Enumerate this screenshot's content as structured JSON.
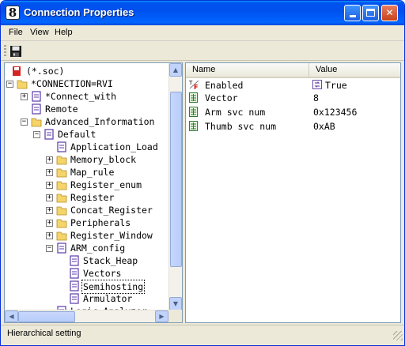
{
  "window": {
    "title": "Connection Properties"
  },
  "menu": {
    "file": "File",
    "view": "View",
    "help": "Help"
  },
  "toolbar": {
    "save_icon": "save-icon"
  },
  "tree": {
    "nodes": [
      {
        "label": "(*.soc)",
        "icon": "soc-file-icon"
      },
      {
        "label": "*CONNECTION=RVI",
        "icon": "folder-icon"
      },
      {
        "label": "*Connect_with",
        "icon": "page-icon"
      },
      {
        "label": "Remote",
        "icon": "page-icon"
      },
      {
        "label": "Advanced_Information",
        "icon": "folder-icon"
      },
      {
        "label": "Default",
        "icon": "page-icon"
      },
      {
        "label": "Application_Load",
        "icon": "page-icon"
      },
      {
        "label": "Memory_block",
        "icon": "folder-icon"
      },
      {
        "label": "Map_rule",
        "icon": "folder-icon"
      },
      {
        "label": "Register_enum",
        "icon": "folder-icon"
      },
      {
        "label": "Register",
        "icon": "folder-icon"
      },
      {
        "label": "Concat_Register",
        "icon": "folder-icon"
      },
      {
        "label": "Peripherals",
        "icon": "folder-icon"
      },
      {
        "label": "Register_Window",
        "icon": "folder-icon"
      },
      {
        "label": "ARM_config",
        "icon": "page-icon"
      },
      {
        "label": "Stack_Heap",
        "icon": "page-icon"
      },
      {
        "label": "Vectors",
        "icon": "page-icon"
      },
      {
        "label": "Semihosting",
        "icon": "page-icon"
      },
      {
        "label": "Armulator",
        "icon": "page-icon"
      },
      {
        "label": "Logic_Analyzer",
        "icon": "page-icon"
      }
    ]
  },
  "properties": {
    "col_name": "Name",
    "col_value": "Value",
    "rows": [
      {
        "name": "Enabled",
        "value": "True",
        "icon": "boolean-icon"
      },
      {
        "name": "Vector",
        "value": "8",
        "icon": "numeric-icon"
      },
      {
        "name": "Arm svc num",
        "value": "0x123456",
        "icon": "numeric-icon"
      },
      {
        "name": "Thumb svc num",
        "value": "0xAB",
        "icon": "numeric-icon"
      }
    ]
  },
  "status": {
    "text": "Hierarchical setting"
  }
}
